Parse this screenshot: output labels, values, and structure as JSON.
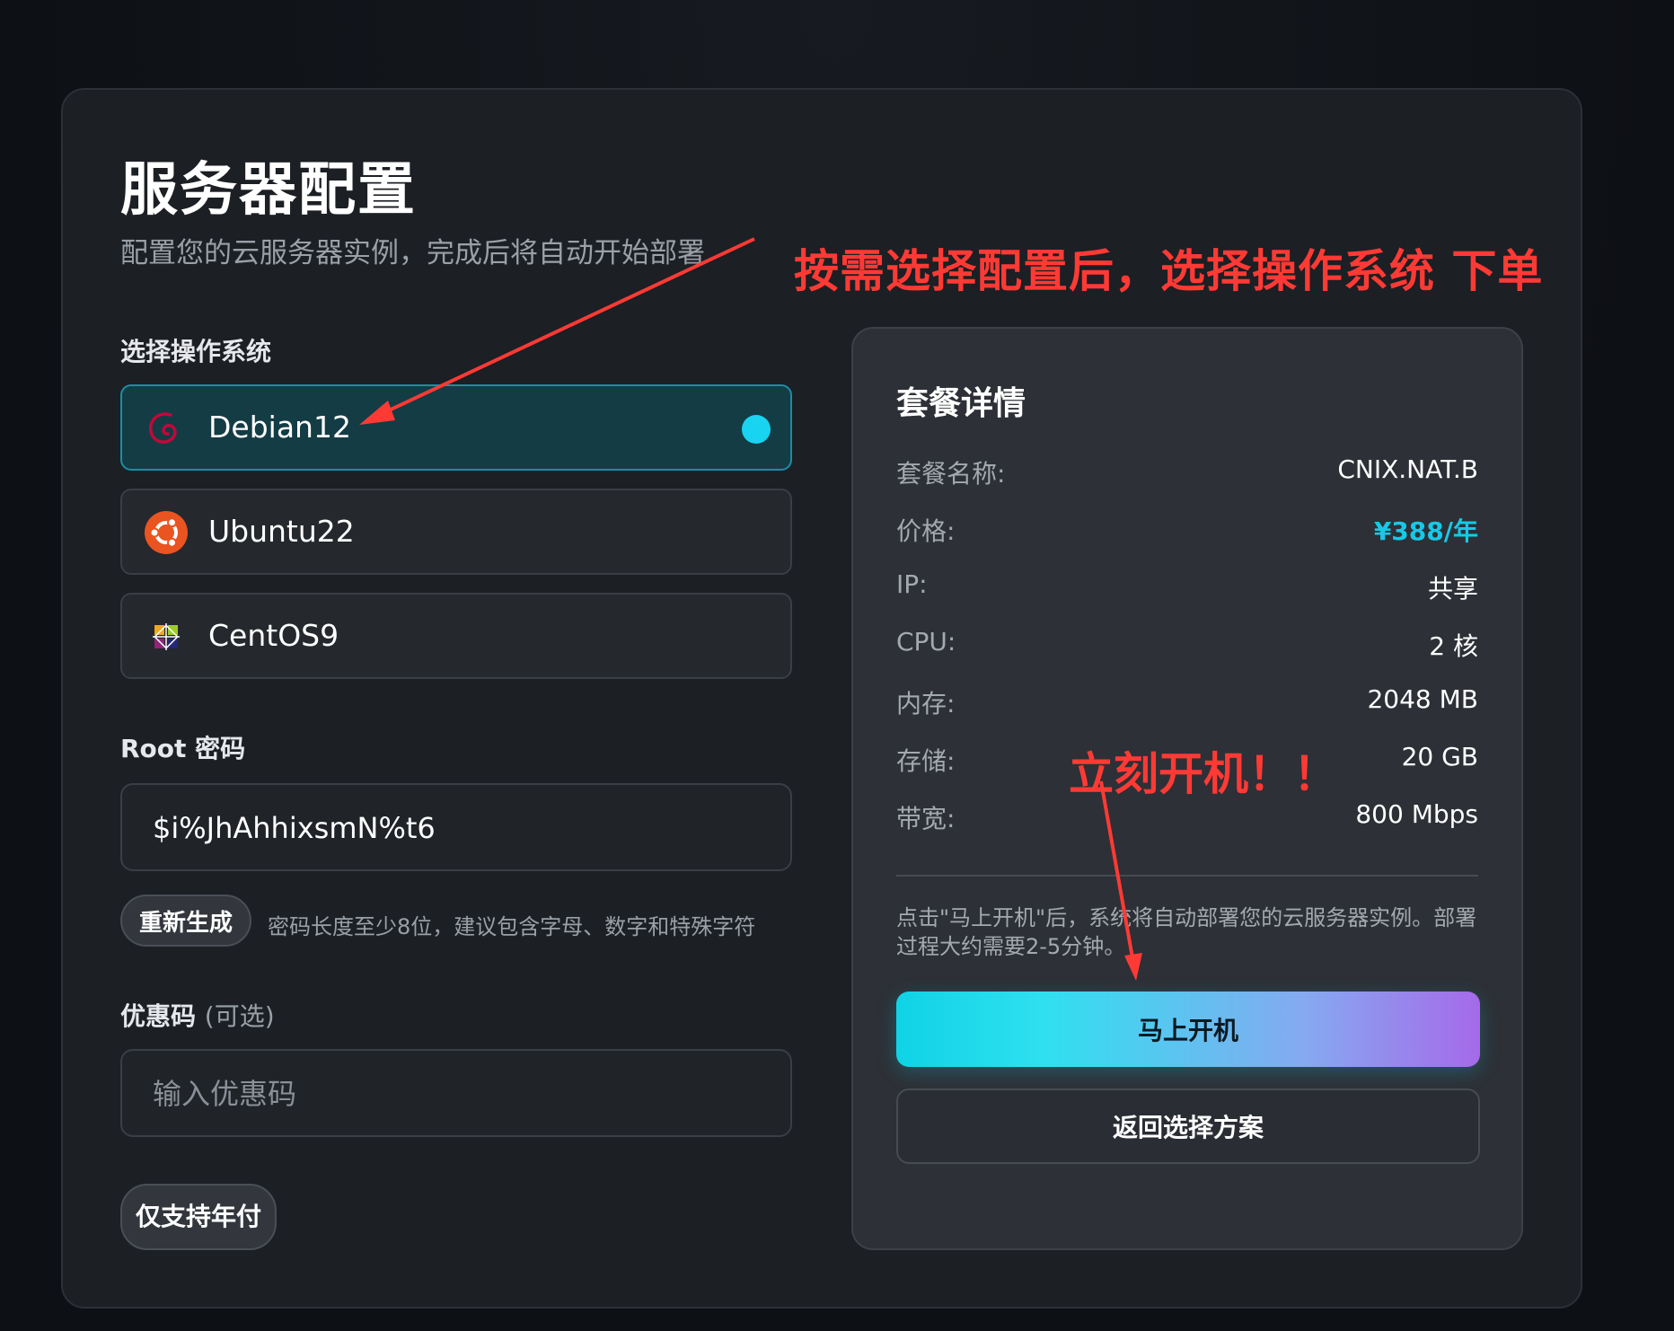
{
  "header": {
    "title": "服务器配置",
    "subtitle": "配置您的云服务器实例，完成后将自动开始部署"
  },
  "annotations": {
    "top": "按需选择配置后，选择操作系统 下单",
    "middle": "立刻开机！！",
    "color": "#ff3a35"
  },
  "os_section": {
    "label": "选择操作系统",
    "options": [
      {
        "label": "Debian12",
        "icon": "debian-swirl-icon",
        "selected": true
      },
      {
        "label": "Ubuntu22",
        "icon": "ubuntu-circle-icon",
        "selected": false
      },
      {
        "label": "CentOS9",
        "icon": "centos-pinwheel-icon",
        "selected": false
      }
    ]
  },
  "password_section": {
    "label": "Root 密码",
    "value": "$i%JhAhhixsmN%t6",
    "regenerate_label": "重新生成",
    "hint": "密码长度至少8位，建议包含字母、数字和特殊字符"
  },
  "coupon_section": {
    "label": "优惠码",
    "optional": "(可选)",
    "placeholder": "输入优惠码"
  },
  "billing": {
    "badge": "仅支持年付"
  },
  "summary": {
    "title": "套餐详情",
    "rows": [
      {
        "label": "套餐名称:",
        "value": "CNIX.NAT.B"
      },
      {
        "label": "价格:",
        "value": "¥388/年"
      },
      {
        "label": "IP:",
        "value": "共享"
      },
      {
        "label": "CPU:",
        "value": "2 核"
      },
      {
        "label": "内存:",
        "value": "2048 MB"
      },
      {
        "label": "存储:",
        "value": "20 GB"
      },
      {
        "label": "带宽:",
        "value": "800 Mbps"
      }
    ],
    "note": "点击\"马上开机\"后，系统将自动部署您的云服务器实例。部署过程大约需要2-5分钟。",
    "primary_button": "马上开机",
    "secondary_button": "返回选择方案"
  },
  "colors": {
    "accent": "#18c8e6",
    "selected_bg": "#143c45",
    "card_bg": "#1c1f24",
    "summary_bg": "#2d3036"
  }
}
